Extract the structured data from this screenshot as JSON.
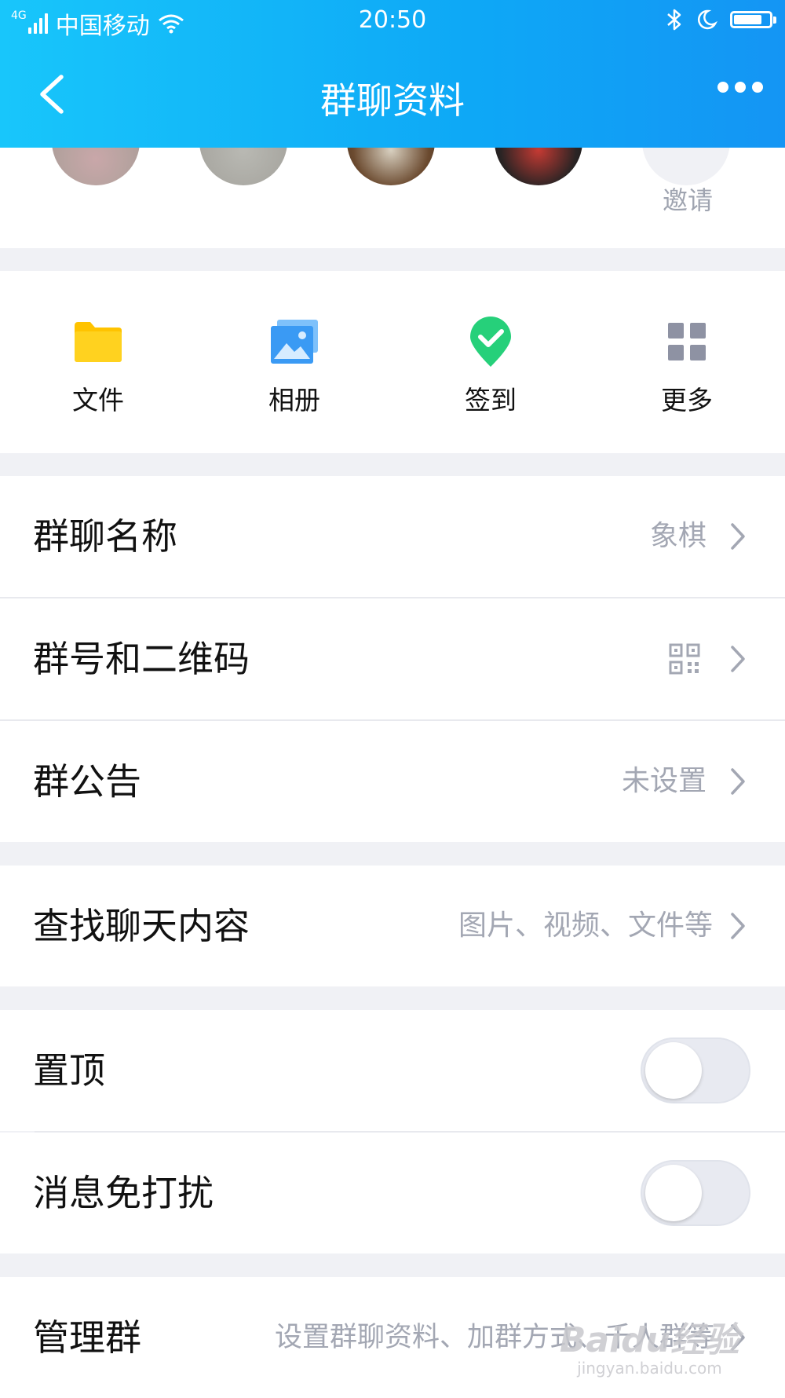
{
  "status_bar": {
    "network": "4G",
    "carrier": "中国移动",
    "time": "20:50",
    "battery_level": 0.8
  },
  "nav": {
    "title": "群聊资料",
    "back_icon": "chevron-left-icon",
    "more_icon": "more-dots-icon"
  },
  "members": {
    "invite_label": "邀请"
  },
  "apps": [
    {
      "label": "文件",
      "icon": "folder-icon",
      "color": "#ffc300"
    },
    {
      "label": "相册",
      "icon": "photo-album-icon",
      "color": "#3a9af4"
    },
    {
      "label": "签到",
      "icon": "check-in-pin-icon",
      "color": "#26d07a"
    },
    {
      "label": "更多",
      "icon": "grid-more-icon",
      "color": "#8e92a3"
    }
  ],
  "settings": {
    "group_name": {
      "label": "群聊名称",
      "value": "象棋"
    },
    "group_qr": {
      "label": "群号和二维码",
      "icon": "qr-code-icon"
    },
    "announcement": {
      "label": "群公告",
      "value": "未设置"
    },
    "search_chat": {
      "label": "查找聊天内容",
      "value": "图片、视频、文件等"
    },
    "pin_top": {
      "label": "置顶",
      "on": false
    },
    "mute": {
      "label": "消息免打扰",
      "on": false
    },
    "manage": {
      "label": "管理群",
      "value": "设置群聊资料、加群方式、千人群等"
    }
  },
  "watermark": {
    "main": "Baidu经验",
    "sub": "jingyan.baidu.com"
  }
}
